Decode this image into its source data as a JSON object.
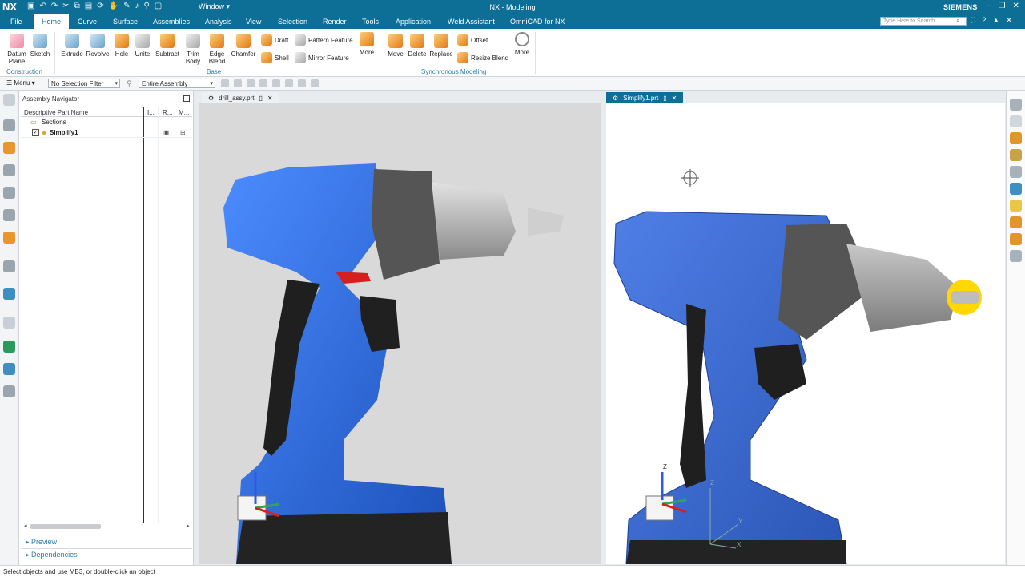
{
  "app": {
    "logo": "NX",
    "title": "NX - Modeling",
    "brand": "SIEMENS",
    "window_menu": "Window"
  },
  "menu_tabs": [
    "File",
    "Home",
    "Curve",
    "Surface",
    "Assemblies",
    "Analysis",
    "View",
    "Selection",
    "Render",
    "Tools",
    "Application",
    "Weld Assistant",
    "OmniCAD for NX"
  ],
  "search": {
    "placeholder": "Type Here to Search"
  },
  "ribbon": {
    "construction": {
      "datum": "Datum Plane",
      "sketch": "Sketch",
      "label": "Construction"
    },
    "base": {
      "extrude": "Extrude",
      "revolve": "Revolve",
      "hole": "Hole",
      "unite": "Unite",
      "subtract": "Subtract",
      "trim": "Trim Body",
      "edge": "Edge Blend",
      "chamfer": "Chamfer",
      "draft": "Draft",
      "shell": "Shell",
      "pattern": "Pattern Feature",
      "mirror": "Mirror Feature",
      "more": "More",
      "label": "Base"
    },
    "sync": {
      "move": "Move",
      "delete": "Delete",
      "replace": "Replace",
      "offset": "Offset",
      "resize": "Resize Blend",
      "more": "More",
      "label": "Synchronous Modeling"
    }
  },
  "selection_bar": {
    "menu": "Menu",
    "filter": "No Selection Filter",
    "scope": "Entire Assembly"
  },
  "navigator": {
    "title": "Assembly Navigator",
    "columns": [
      "Descriptive Part Name",
      "I...",
      "R...",
      "M..."
    ],
    "rows": [
      {
        "name": "Sections"
      },
      {
        "name": "Simplify1"
      }
    ],
    "preview": "Preview",
    "dependencies": "Dependencies"
  },
  "tabs": {
    "left": "drill_assy.prt",
    "right": "Simplify1.prt"
  },
  "status": "Select objects and use MB3, or double-click an object",
  "colors": {
    "accent": "#0d6f96",
    "drill_blue": "#2f6fe0",
    "drill_gray": "#5a5a5a",
    "chuck": "#b9b9b9",
    "trigger": "#d61f1f",
    "highlight": "#ffd800"
  },
  "axis_labels": {
    "z": "Z",
    "x": "X",
    "y": "Y"
  }
}
